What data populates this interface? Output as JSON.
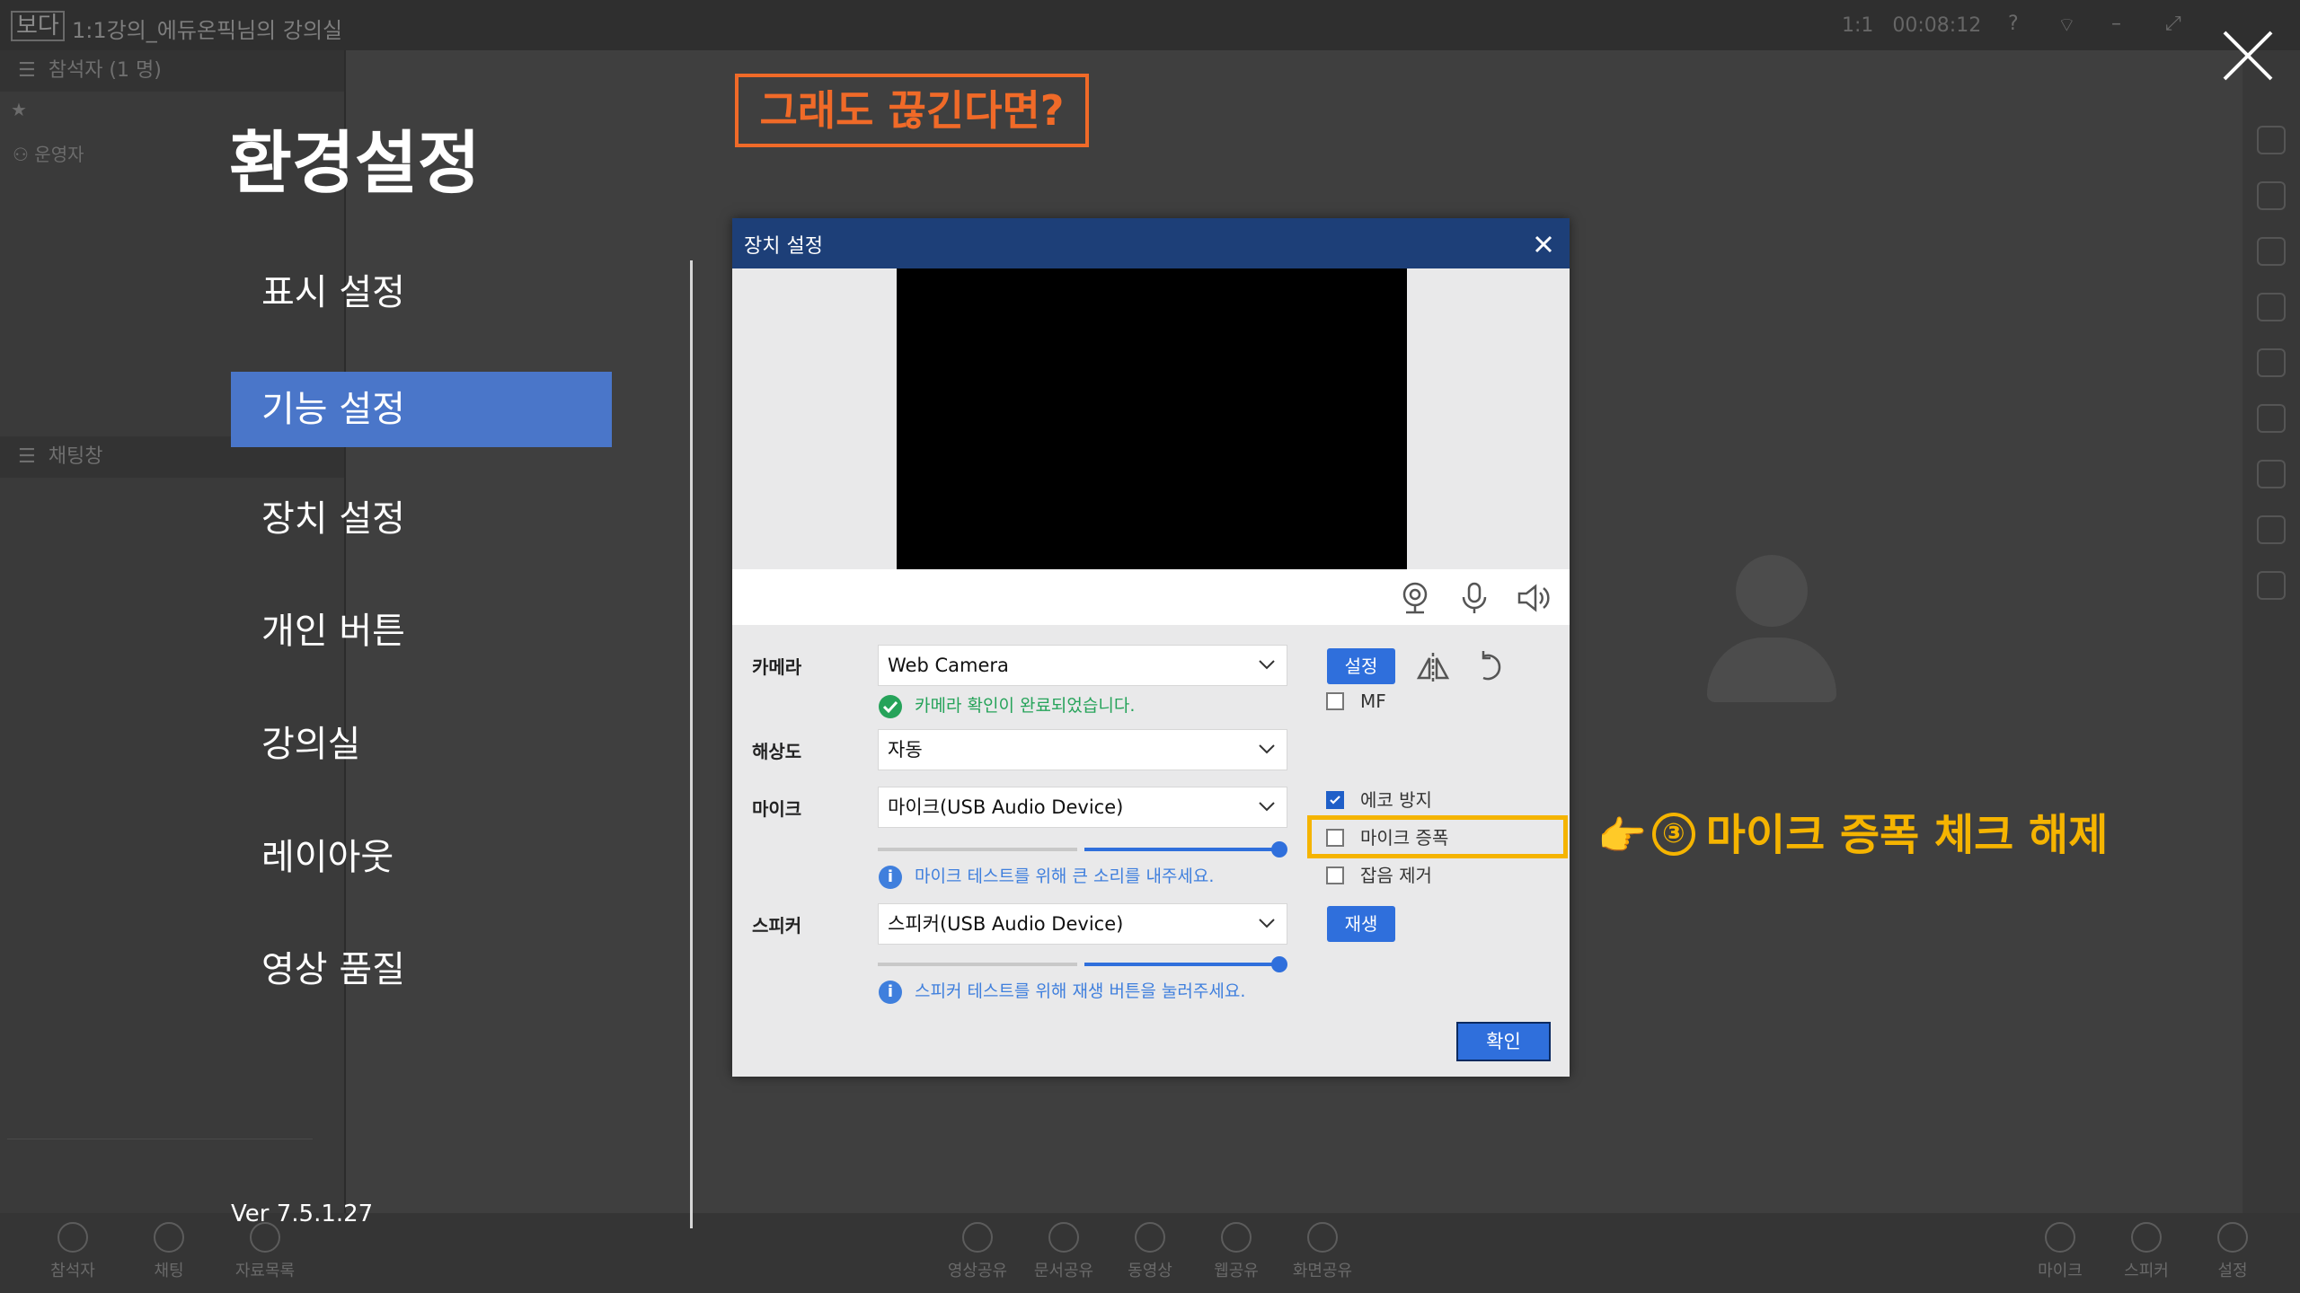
{
  "background": {
    "logo": "보다",
    "title": "1:1강의_에듀온픽님의 강의실",
    "mode": "1:1",
    "timer": "00:08:12",
    "participants_header": "참석자 (1 명)",
    "participant": "운영자",
    "chat_header": "채팅창",
    "bottom_left": [
      "참석자",
      "채팅",
      "자료목록"
    ],
    "bottom_center": [
      "영상공유",
      "문서공유",
      "동영상",
      "웹공유",
      "화면공유"
    ],
    "bottom_right": [
      "마이크",
      "스피커",
      "설정"
    ]
  },
  "settings": {
    "title": "환경설정",
    "menu": [
      "표시 설정",
      "기능 설정",
      "장치 설정",
      "개인 버튼",
      "강의실",
      "레이아웃",
      "영상 품질"
    ],
    "active_index": 1,
    "version": "Ver 7.5.1.27"
  },
  "banner": "그래도 끊긴다면?",
  "dialog": {
    "title": "장치 설정",
    "camera": {
      "label": "카메라",
      "value": "Web Camera",
      "status": "카메라 확인이 완료되었습니다.",
      "setting_button": "설정",
      "mf_label": "MF",
      "mf_checked": false
    },
    "resolution": {
      "label": "해상도",
      "value": "자동"
    },
    "mic": {
      "label": "마이크",
      "value": "마이크(USB Audio Device)",
      "level": 1.0,
      "hint": "마이크 테스트를 위해 큰 소리를 내주세요."
    },
    "speaker": {
      "label": "스피커",
      "value": "스피커(USB Audio Device)",
      "level": 1.0,
      "hint": "스피커 테스트를 위해 재생 버튼을 눌러주세요.",
      "play_button": "재생"
    },
    "options": [
      {
        "label": "에코 방지",
        "checked": true
      },
      {
        "label": "마이크 증폭",
        "checked": false
      },
      {
        "label": "잡음 제거",
        "checked": false
      }
    ],
    "confirm": "확인"
  },
  "callout": {
    "number": "③",
    "text": "마이크 증폭 체크 해제"
  },
  "colors": {
    "accent_blue": "#2f6fdc",
    "header_navy": "#1d3f78",
    "callout_yellow": "#f5b400",
    "banner_orange": "#f06a28",
    "active_menu": "#4a76c9"
  }
}
